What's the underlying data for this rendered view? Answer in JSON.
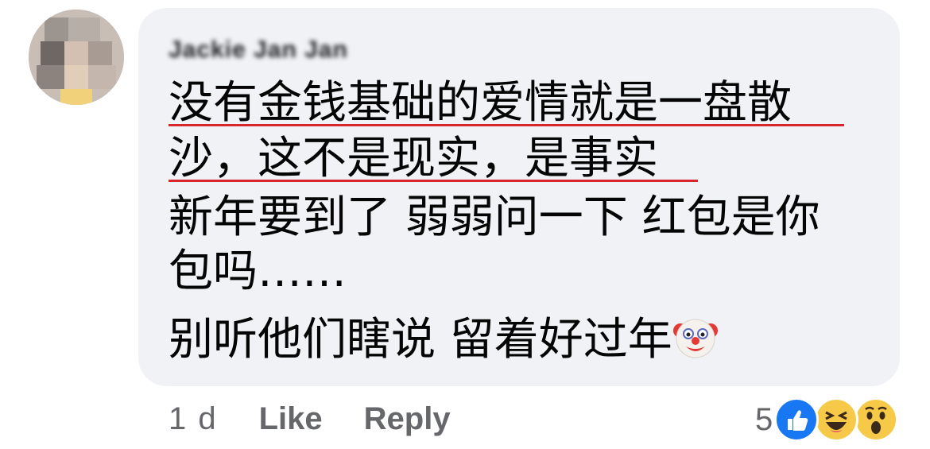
{
  "comment": {
    "author": "Jackie Jan Jan",
    "lines": [
      "没有金钱基础的爱情就是一盘散",
      "沙，这不是现实，是事实",
      "新年要到了 弱弱问一下 红包是你",
      "包吗……",
      "别听他们瞎说 留着好过年"
    ],
    "timestamp": "1 d",
    "like_label": "Like",
    "reply_label": "Reply",
    "reaction_count": "5",
    "reactions": [
      "like-icon",
      "haha-icon",
      "wow-icon"
    ],
    "emoji": "clown-face-icon"
  },
  "colors": {
    "bubble": "#f0f2f5",
    "underline": "#d7262e",
    "like_blue": "#1877f2",
    "meta_text": "#65676b"
  }
}
